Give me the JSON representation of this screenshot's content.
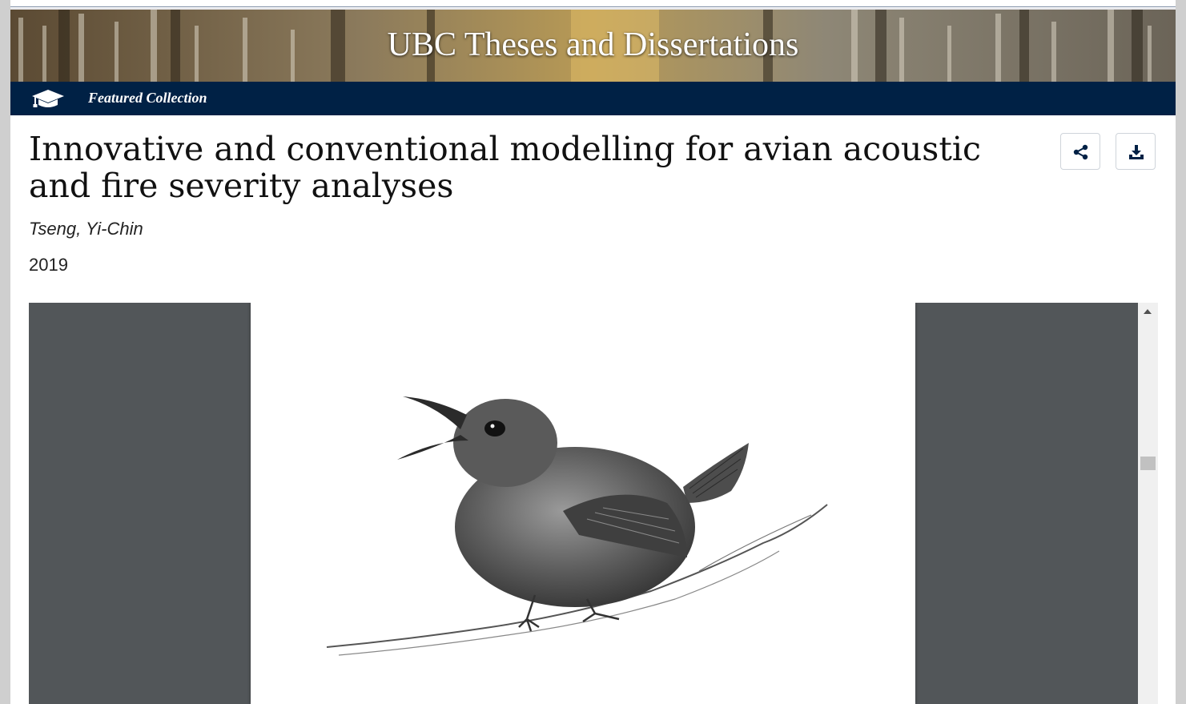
{
  "banner": {
    "title": "UBC Theses and Dissertations"
  },
  "collection": {
    "label": "Featured Collection",
    "icon": "graduation-cap-icon"
  },
  "document": {
    "title": "Innovative and conventional modelling for avian acoustic and fire severity analyses",
    "author": "Tseng, Yi-Chin",
    "year": "2019"
  },
  "actions": {
    "share_icon": "share-icon",
    "download_icon": "download-icon"
  },
  "colors": {
    "nav_bar": "#002145",
    "viewer_bg": "#525659",
    "icon_accent": "#002145"
  }
}
